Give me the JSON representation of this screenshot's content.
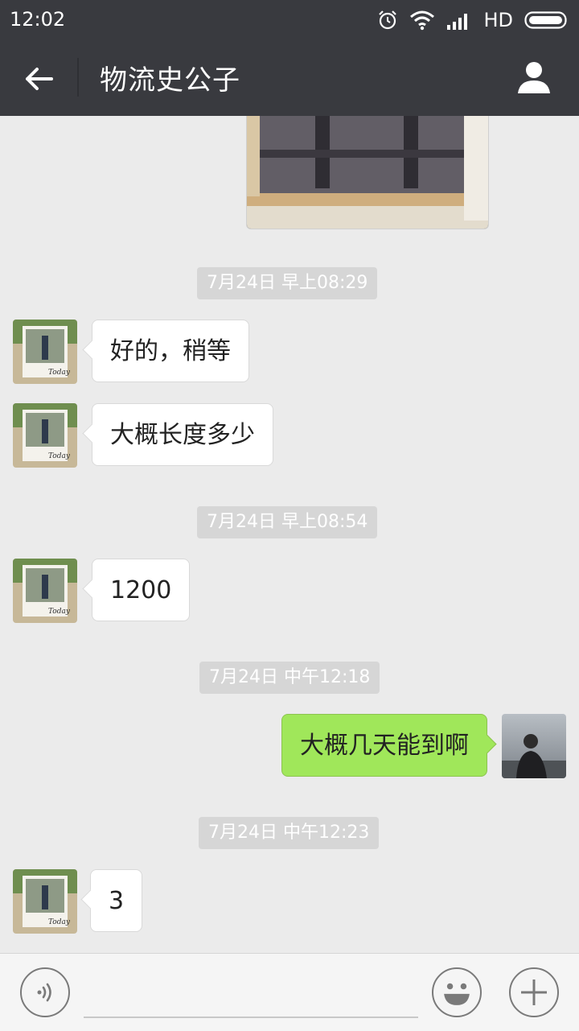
{
  "status_bar": {
    "time": "12:02",
    "network": "HD"
  },
  "header": {
    "title": "物流史公子"
  },
  "messages": [
    {
      "type": "timestamp",
      "text": "7月24日 早上08:29"
    },
    {
      "type": "incoming",
      "text": "好的，稍等"
    },
    {
      "type": "incoming",
      "text": "大概长度多少"
    },
    {
      "type": "timestamp",
      "text": "7月24日 早上08:54"
    },
    {
      "type": "incoming",
      "text": "1200"
    },
    {
      "type": "timestamp",
      "text": "7月24日 中午12:18"
    },
    {
      "type": "outgoing",
      "text": "大概几天能到啊"
    },
    {
      "type": "timestamp",
      "text": "7月24日 中午12:23"
    },
    {
      "type": "incoming",
      "text": "3"
    }
  ],
  "colors": {
    "header_bg": "#393a3f",
    "chat_bg": "#ebebeb",
    "outgoing_bubble": "#a0e75a",
    "incoming_bubble": "#ffffff"
  },
  "icons": [
    "back-arrow-icon",
    "profile-icon",
    "alarm-icon",
    "wifi-icon",
    "signal-icon",
    "battery-icon",
    "voice-icon",
    "emoji-icon",
    "plus-icon"
  ]
}
